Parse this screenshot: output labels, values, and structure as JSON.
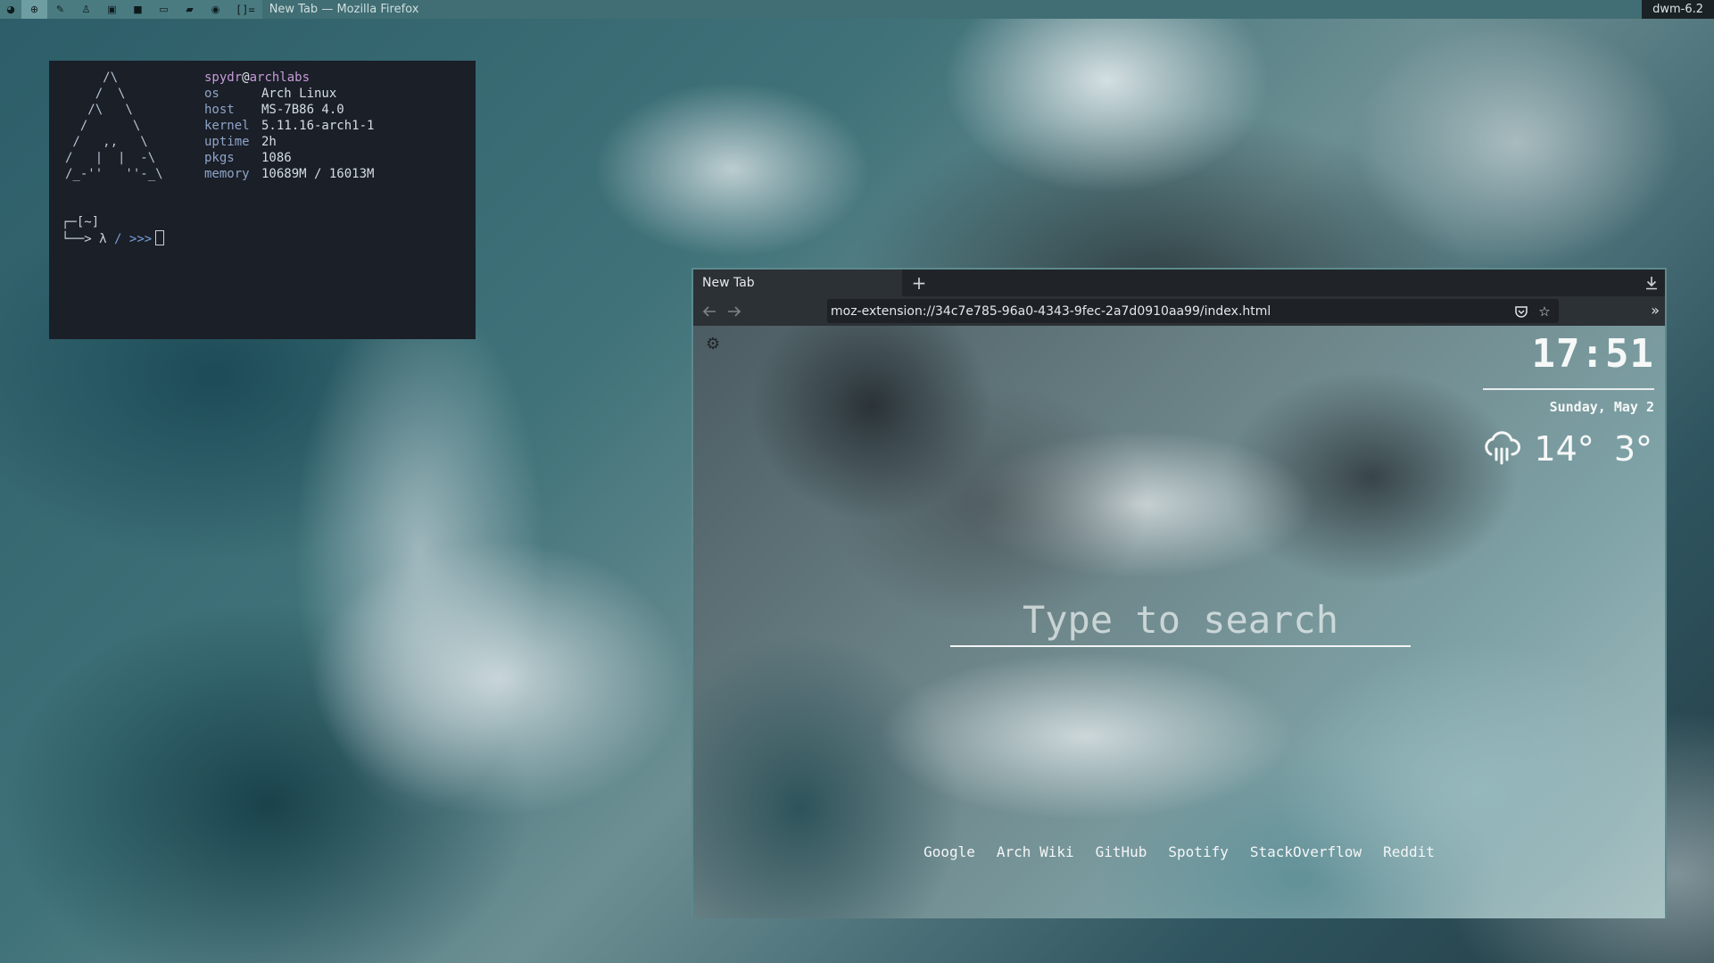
{
  "topbar": {
    "tags": [
      "archlabs",
      "globe",
      "brush",
      "person",
      "image",
      "video",
      "laptop",
      "folder",
      "disc"
    ],
    "layout_symbol": "[]=",
    "window_title": "New Tab — Mozilla Firefox",
    "status": "dwm-6.2"
  },
  "terminal": {
    "ascii_logo": "     /\\\n    /  \\\n   /\\   \\\n  /      \\\n /   ,,   \\\n/   |  |  -\\\n/_-''   ''-_\\",
    "user": "spydr",
    "at": "@",
    "host": "archlabs",
    "info": [
      {
        "key": "os",
        "value": "Arch Linux"
      },
      {
        "key": "host",
        "value": "MS-7B86 4.0"
      },
      {
        "key": "kernel",
        "value": "5.11.16-arch1-1"
      },
      {
        "key": "uptime",
        "value": "2h"
      },
      {
        "key": "pkgs",
        "value": "1086"
      },
      {
        "key": "memory",
        "value": "10689M / 16013M"
      }
    ],
    "prompt_dir": "┌─[~]",
    "prompt_line": "└──> λ",
    "prompt_path": "/",
    "prompt_chevrons": ">>>"
  },
  "browser": {
    "tab_title": "New Tab",
    "new_tab_symbol": "+",
    "url": "moz-extension://34c7e785-96a0-4343-9fec-2a7d0910aa99/index.html",
    "clock": "17:51",
    "date": "Sunday, May 2",
    "weather_icon": "rain-cloud-icon",
    "temp_high": "14°",
    "temp_low": "3°",
    "search_placeholder": "Type to search",
    "links": [
      "Google",
      "Arch Wiki",
      "GitHub",
      "Spotify",
      "StackOverflow",
      "Reddit"
    ]
  }
}
